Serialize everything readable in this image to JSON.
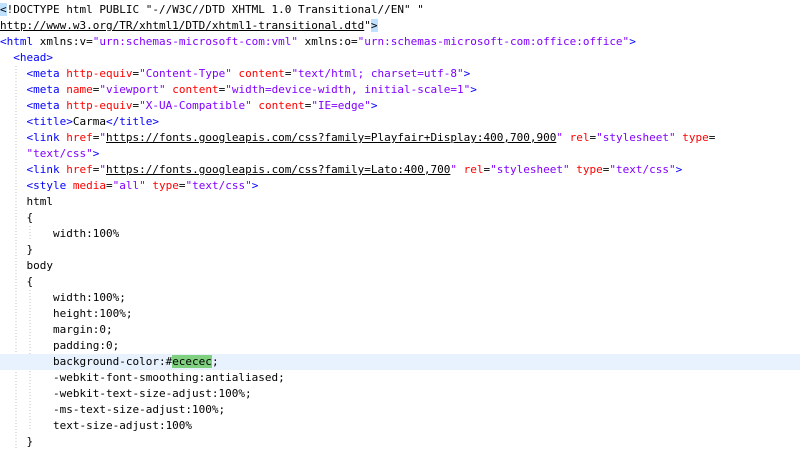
{
  "editor": {
    "highlight_color": "#e8f2fe",
    "match_color": "#7fd07f",
    "lines": [
      [
        {
          "t": "<",
          "c": "hl-sel"
        },
        {
          "t": "!DOCTYPE html PUBLIC \"-//W3C//DTD XHTML 1.0 Transitional//EN\" \"",
          "c": "plain"
        }
      ],
      [
        {
          "t": "http://www.w3.org/TR/xhtml1/DTD/xhtml1-transitional.dtd",
          "c": "url"
        },
        {
          "t": "\"",
          "c": "plain"
        },
        {
          "t": ">",
          "c": "hl-sel"
        }
      ],
      [
        {
          "t": "<html ",
          "c": "tag"
        },
        {
          "t": "xmlns:v",
          "c": "plain"
        },
        {
          "t": "=",
          "c": "plain"
        },
        {
          "t": "\"urn:schemas-microsoft-com:vml\"",
          "c": "val"
        },
        {
          "t": " xmlns:o",
          "c": "plain"
        },
        {
          "t": "=",
          "c": "plain"
        },
        {
          "t": "\"urn:schemas-microsoft-com:office:office\"",
          "c": "val"
        },
        {
          "t": ">",
          "c": "tag"
        }
      ],
      [
        {
          "t": "  ",
          "c": "plain"
        },
        {
          "t": "<head>",
          "c": "tag"
        }
      ],
      [
        {
          "t": "    ",
          "c": "plain"
        },
        {
          "t": "<meta ",
          "c": "tag"
        },
        {
          "t": "http-equiv",
          "c": "attr"
        },
        {
          "t": "=",
          "c": "plain"
        },
        {
          "t": "\"Content-Type\"",
          "c": "val"
        },
        {
          "t": " content",
          "c": "attr"
        },
        {
          "t": "=",
          "c": "plain"
        },
        {
          "t": "\"text/html; charset=utf-8\"",
          "c": "val"
        },
        {
          "t": ">",
          "c": "tag"
        }
      ],
      [
        {
          "t": "    ",
          "c": "plain"
        },
        {
          "t": "<meta ",
          "c": "tag"
        },
        {
          "t": "name",
          "c": "attr"
        },
        {
          "t": "=",
          "c": "plain"
        },
        {
          "t": "\"viewport\"",
          "c": "val"
        },
        {
          "t": " content",
          "c": "attr"
        },
        {
          "t": "=",
          "c": "plain"
        },
        {
          "t": "\"width=device-width, initial-scale=1\"",
          "c": "val"
        },
        {
          "t": ">",
          "c": "tag"
        }
      ],
      [
        {
          "t": "    ",
          "c": "plain"
        },
        {
          "t": "<meta ",
          "c": "tag"
        },
        {
          "t": "http-equiv",
          "c": "attr"
        },
        {
          "t": "=",
          "c": "plain"
        },
        {
          "t": "\"X-UA-Compatible\"",
          "c": "val"
        },
        {
          "t": " content",
          "c": "attr"
        },
        {
          "t": "=",
          "c": "plain"
        },
        {
          "t": "\"IE=edge\"",
          "c": "val"
        },
        {
          "t": ">",
          "c": "tag"
        }
      ],
      [
        {
          "t": "    ",
          "c": "plain"
        },
        {
          "t": "<title>",
          "c": "tag"
        },
        {
          "t": "Carma",
          "c": "plain"
        },
        {
          "t": "</title>",
          "c": "tag"
        }
      ],
      [
        {
          "t": "    ",
          "c": "plain"
        },
        {
          "t": "<link ",
          "c": "tag"
        },
        {
          "t": "href",
          "c": "attr"
        },
        {
          "t": "=",
          "c": "plain"
        },
        {
          "t": "\"",
          "c": "val"
        },
        {
          "t": "https://fonts.googleapis.com/css?family=Playfair+Display:400,700,900",
          "c": "url"
        },
        {
          "t": "\"",
          "c": "val"
        },
        {
          "t": " rel",
          "c": "attr"
        },
        {
          "t": "=",
          "c": "plain"
        },
        {
          "t": "\"stylesheet\"",
          "c": "val"
        },
        {
          "t": " type",
          "c": "attr"
        },
        {
          "t": "=",
          "c": "plain"
        }
      ],
      [
        {
          "t": "    ",
          "c": "plain"
        },
        {
          "t": "\"text/css\"",
          "c": "val"
        },
        {
          "t": ">",
          "c": "tag"
        }
      ],
      [
        {
          "t": "    ",
          "c": "plain"
        },
        {
          "t": "<link ",
          "c": "tag"
        },
        {
          "t": "href",
          "c": "attr"
        },
        {
          "t": "=",
          "c": "plain"
        },
        {
          "t": "\"",
          "c": "val"
        },
        {
          "t": "https://fonts.googleapis.com/css?family=Lato:400,700",
          "c": "url"
        },
        {
          "t": "\"",
          "c": "val"
        },
        {
          "t": " rel",
          "c": "attr"
        },
        {
          "t": "=",
          "c": "plain"
        },
        {
          "t": "\"stylesheet\"",
          "c": "val"
        },
        {
          "t": " type",
          "c": "attr"
        },
        {
          "t": "=",
          "c": "plain"
        },
        {
          "t": "\"text/css\"",
          "c": "val"
        },
        {
          "t": ">",
          "c": "tag"
        }
      ],
      [
        {
          "t": "    ",
          "c": "plain"
        },
        {
          "t": "<style ",
          "c": "tag"
        },
        {
          "t": "media",
          "c": "attr"
        },
        {
          "t": "=",
          "c": "plain"
        },
        {
          "t": "\"all\"",
          "c": "val"
        },
        {
          "t": " type",
          "c": "attr"
        },
        {
          "t": "=",
          "c": "plain"
        },
        {
          "t": "\"text/css\"",
          "c": "val"
        },
        {
          "t": ">",
          "c": "tag"
        }
      ],
      [
        {
          "t": "    html",
          "c": "plain"
        }
      ],
      [
        {
          "t": "    {",
          "c": "plain"
        }
      ],
      [
        {
          "t": "        width:100%",
          "c": "plain"
        }
      ],
      [
        {
          "t": "    }",
          "c": "plain"
        }
      ],
      [
        {
          "t": "    body",
          "c": "plain"
        }
      ],
      [
        {
          "t": "    {",
          "c": "plain"
        }
      ],
      [
        {
          "t": "        width:100%;",
          "c": "plain"
        }
      ],
      [
        {
          "t": "        height:100%;",
          "c": "plain"
        }
      ],
      [
        {
          "t": "        margin:0;",
          "c": "plain"
        }
      ],
      [
        {
          "t": "        padding:0;",
          "c": "plain"
        }
      ],
      [
        {
          "t": "        background-color:#",
          "c": "plain"
        },
        {
          "t": "ececec",
          "c": "hl-match"
        },
        {
          "t": ";",
          "c": "plain"
        }
      ],
      [
        {
          "t": "        -webkit-font-smoothing:antialiased;",
          "c": "plain"
        }
      ],
      [
        {
          "t": "        -webkit-text-size-adjust:100%;",
          "c": "plain"
        }
      ],
      [
        {
          "t": "        -ms-text-size-adjust:100%;",
          "c": "plain"
        }
      ],
      [
        {
          "t": "        text-size-adjust:100%",
          "c": "plain"
        }
      ],
      [
        {
          "t": "    }",
          "c": "plain"
        }
      ]
    ],
    "current_line_index": 22
  }
}
